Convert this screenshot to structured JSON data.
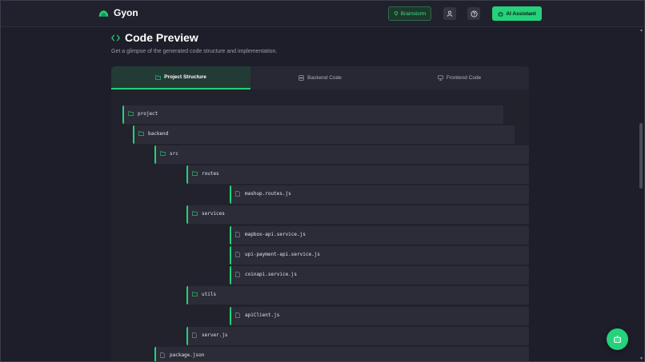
{
  "header": {
    "brand": "Gyon",
    "brainstorm_label": "Brainstorm",
    "ai_assistant_label": "AI Assistant"
  },
  "page": {
    "title": "Code Preview",
    "subtitle": "Get a glimpse of the generated code structure and implementation."
  },
  "tabs": [
    {
      "label": "Project Structure",
      "active": true,
      "icon": "folder-icon"
    },
    {
      "label": "Backend Code",
      "active": false,
      "icon": "server-icon"
    },
    {
      "label": "Frontend Code",
      "active": false,
      "icon": "monitor-icon"
    }
  ],
  "tree": [
    {
      "name": "project",
      "type": "folder",
      "depth": 0
    },
    {
      "name": "backend",
      "type": "folder",
      "depth": 1
    },
    {
      "name": "src",
      "type": "folder",
      "depth": 2
    },
    {
      "name": "routes",
      "type": "folder",
      "depth": 3
    },
    {
      "name": "mashup.routes.js",
      "type": "file",
      "depth": 4
    },
    {
      "name": "services",
      "type": "folder",
      "depth": 3
    },
    {
      "name": "mapbox-api.service.js",
      "type": "file",
      "depth": 4
    },
    {
      "name": "upi-payment-api.service.js",
      "type": "file",
      "depth": 4
    },
    {
      "name": "coinapi.service.js",
      "type": "file",
      "depth": 4
    },
    {
      "name": "utils",
      "type": "folder",
      "depth": 3
    },
    {
      "name": "apiClient.js",
      "type": "file",
      "depth": 4
    },
    {
      "name": "server.js",
      "type": "file",
      "depth": 3
    },
    {
      "name": "package.json",
      "type": "file",
      "depth": 2
    }
  ],
  "colors": {
    "accent": "#25d17a",
    "background": "#1d1e29",
    "panel": "#252631"
  }
}
